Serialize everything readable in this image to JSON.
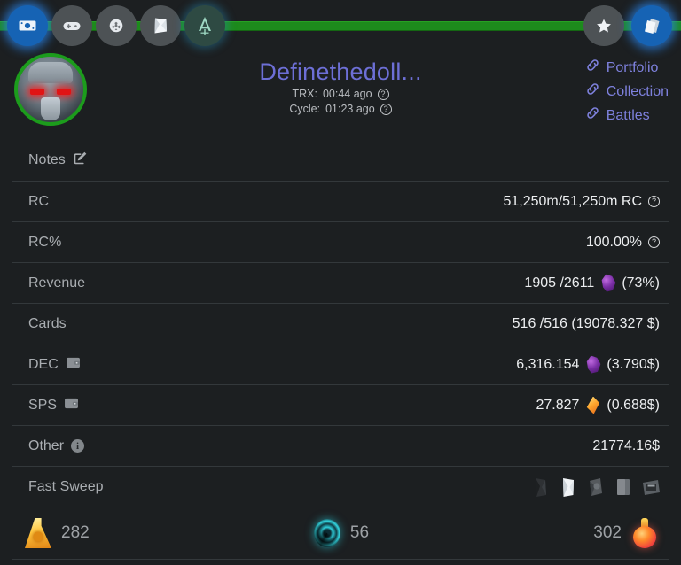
{
  "topnav": {
    "left_items": [
      {
        "name": "banknote-icon",
        "label": "Money",
        "active": true
      },
      {
        "name": "gamepad-icon",
        "label": "Games",
        "active": false
      },
      {
        "name": "shield-icon",
        "label": "Guild",
        "active": false
      },
      {
        "name": "card-icon",
        "label": "Packs",
        "active": false
      },
      {
        "name": "emblem-a-icon",
        "label": "Arcane",
        "active": false
      }
    ],
    "right_items": [
      {
        "name": "star-icon",
        "label": "Favorites",
        "active": false
      },
      {
        "name": "cards-stack-icon",
        "label": "Collection",
        "active": true
      }
    ]
  },
  "header": {
    "avatar_alt": "robot-avatar",
    "username": "Definethedoll...",
    "trx_label": "TRX:",
    "trx_value": "00:44 ago",
    "cycle_label": "Cycle:",
    "cycle_value": "01:23 ago",
    "help_glyph": "?",
    "links": [
      {
        "icon": "link-icon",
        "label": "Portfolio"
      },
      {
        "icon": "link-icon",
        "label": "Collection"
      },
      {
        "icon": "link-icon",
        "label": "Battles"
      }
    ]
  },
  "rows": {
    "notes": {
      "label": "Notes",
      "icon": "edit-pencil-icon"
    },
    "rc": {
      "label": "RC",
      "value": "51,250m/51,250m RC",
      "help": "?"
    },
    "rc_pct": {
      "label": "RC%",
      "value": "100.00%",
      "help": "?"
    },
    "revenue": {
      "label": "Revenue",
      "value": "1905 /2611",
      "currency": "dec",
      "suffix": "(73%)"
    },
    "cards": {
      "label": "Cards",
      "value": "516 /516 (19078.327 $)"
    },
    "dec": {
      "label": "DEC",
      "icon": "wallet-icon",
      "value": "6,316.154",
      "currency": "dec",
      "suffix": "(3.790$)"
    },
    "sps": {
      "label": "SPS",
      "icon": "wallet-icon",
      "value": "27.827",
      "currency": "sps",
      "suffix": "(0.688$)"
    },
    "other": {
      "label": "Other",
      "icon": "info-icon",
      "value": "21774.16$"
    },
    "fast_sweep": {
      "label": "Fast Sweep",
      "icons": [
        "sweep-dark-pack-icon",
        "sweep-white-pack-icon",
        "sweep-grey-pack-icon",
        "sweep-cards-icon",
        "sweep-chest-icon"
      ]
    }
  },
  "footer": {
    "left": {
      "icon": "gold-potion-icon",
      "value": "282"
    },
    "middle": {
      "icon": "vortex-icon",
      "value": "56"
    },
    "right": {
      "icon": "red-potion-icon",
      "value": "302"
    }
  },
  "colors": {
    "background": "#1c1f21",
    "accent_green": "#1d8a1c",
    "title_purple": "#6d6fd6",
    "link_purple": "#7e81dd",
    "active_blue": "#1663b4"
  }
}
